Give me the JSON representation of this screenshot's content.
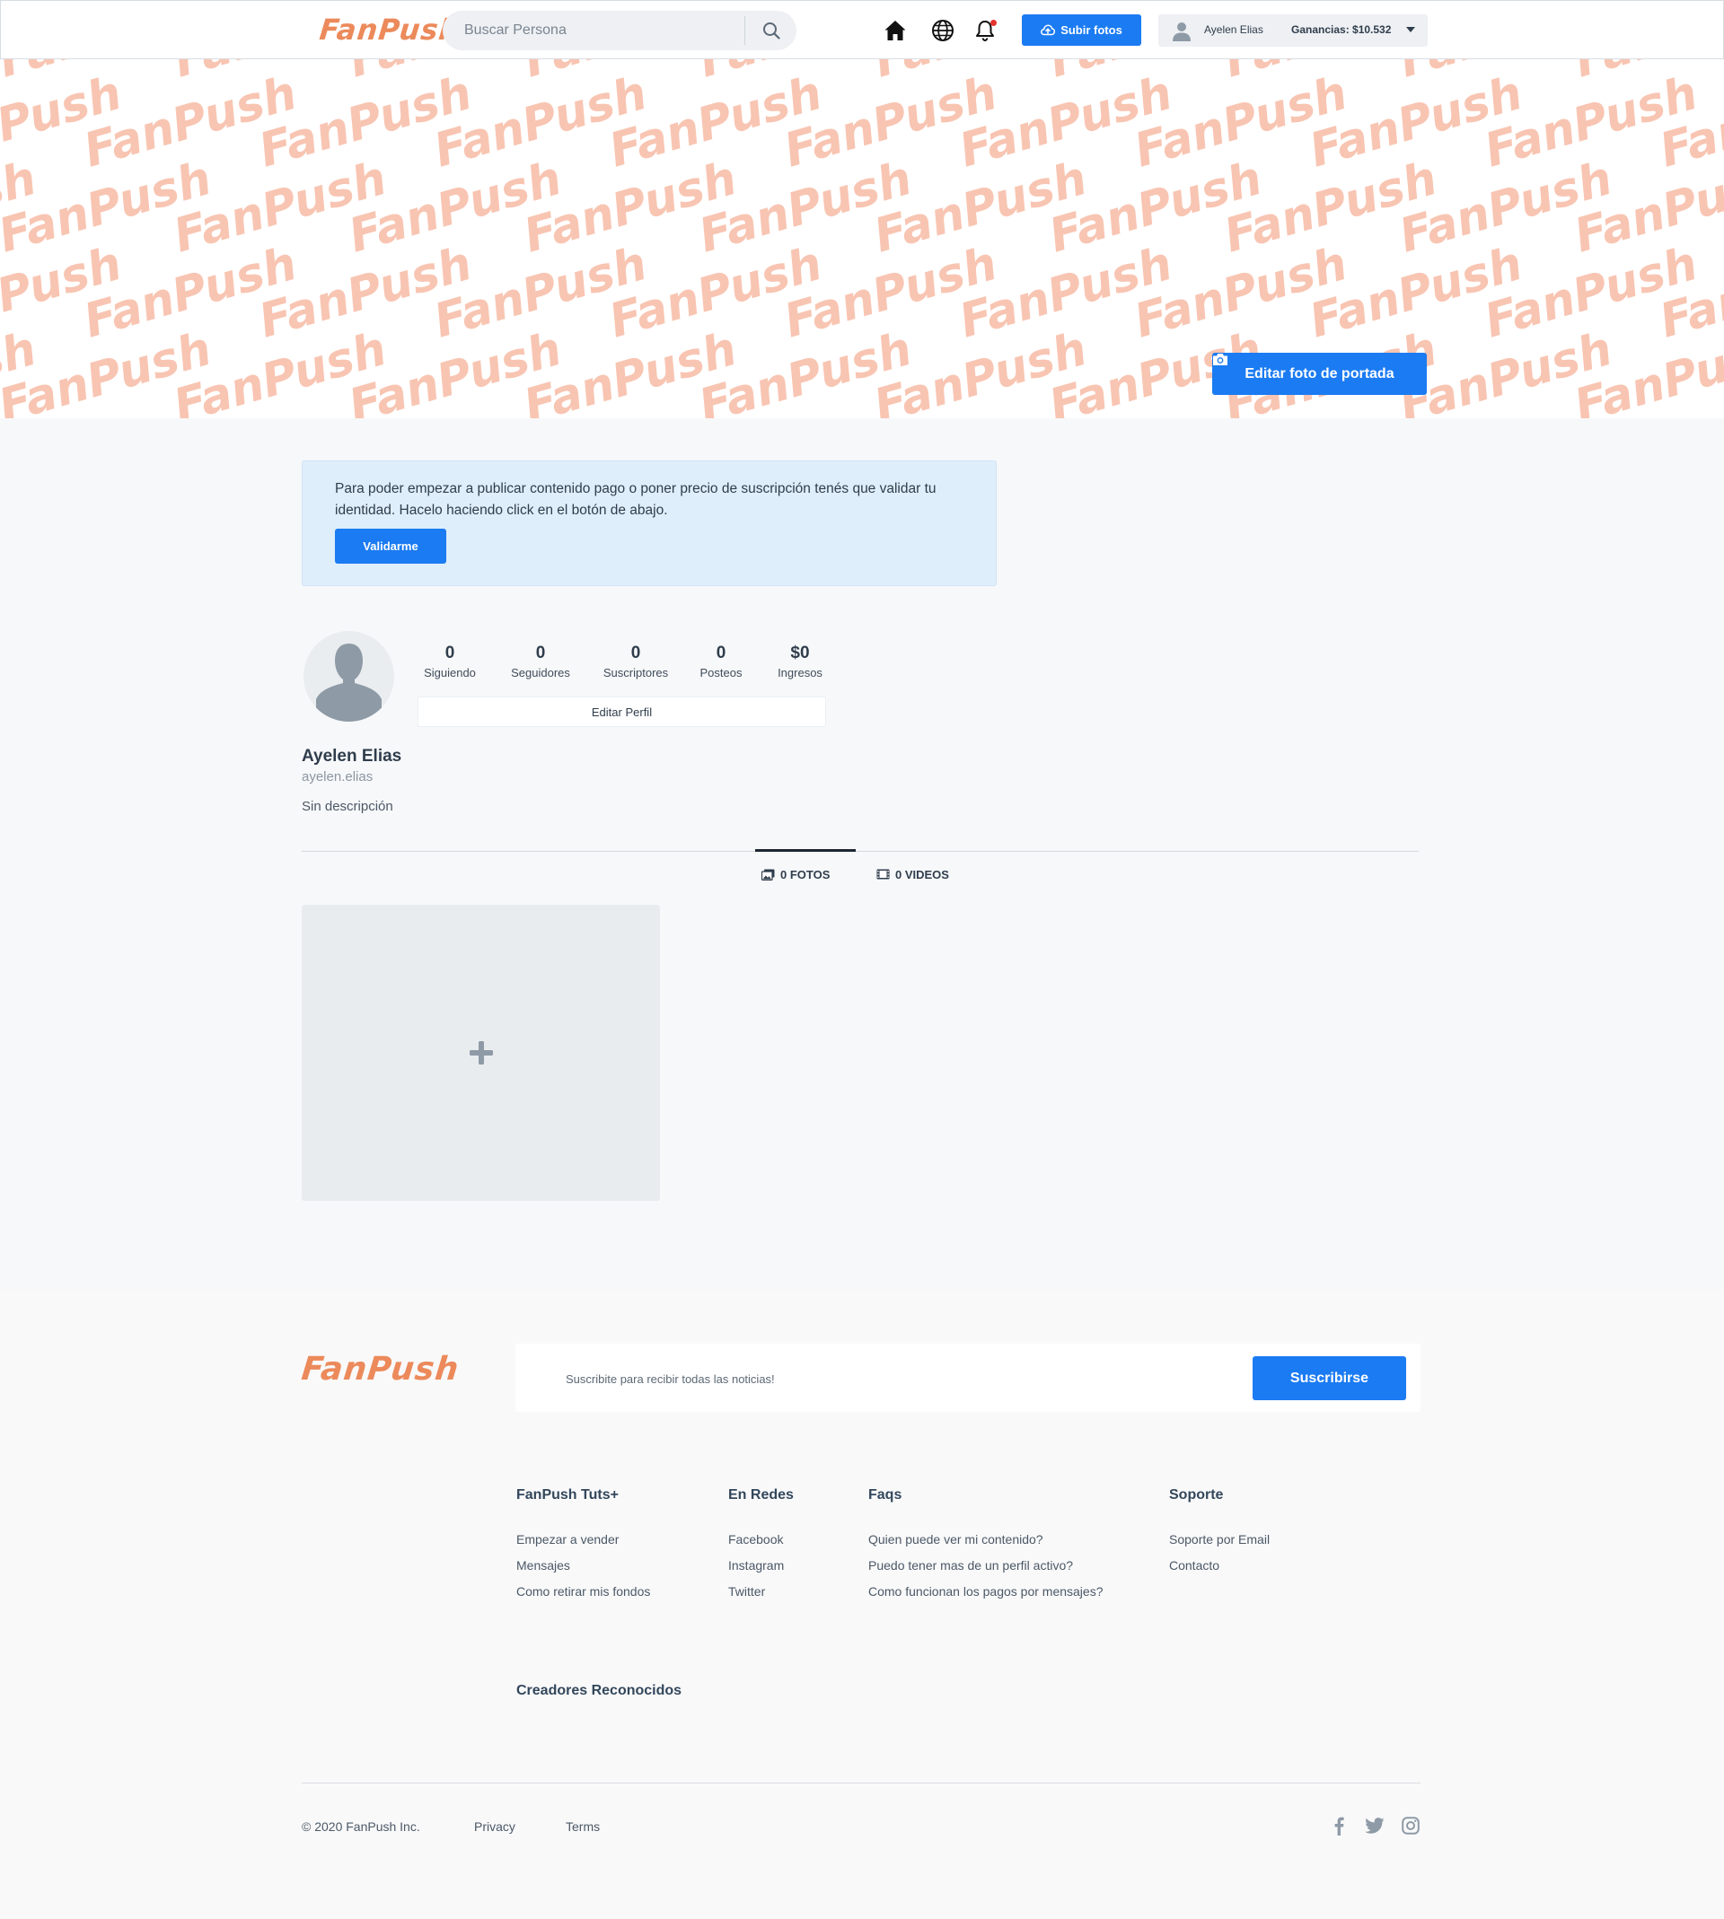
{
  "brand": {
    "name": "FanPush",
    "logo_color": "#ec8a5b",
    "accent": "#1b7bf2"
  },
  "header": {
    "search": {
      "placeholder": "Buscar Persona",
      "icon": "search-icon"
    },
    "nav_icons": [
      "home-icon",
      "globe-icon",
      "bell-icon"
    ],
    "upload_label": "Subir fotos",
    "user_name": "Ayelen Elias",
    "earnings": "Ganancias: $10.532"
  },
  "cover": {
    "watermark_text": "FanPush",
    "watermark_color": "#f8c5b2",
    "edit_cover_label": "Editar foto de portada"
  },
  "alert": {
    "message": "Para poder empezar a publicar contenido pago o poner precio de suscripción tenés que validar tu identidad. Hacelo haciendo click en el botón de abajo.",
    "button_label": "Validarme"
  },
  "profile": {
    "name": "Ayelen Elias",
    "handle": "ayelen.elias",
    "description": "Sin descripción",
    "edit_label": "Editar Perfil",
    "stats": [
      {
        "value": "0",
        "label": "Siguiendo"
      },
      {
        "value": "0",
        "label": "Seguidores"
      },
      {
        "value": "0",
        "label": "Suscriptores"
      },
      {
        "value": "0",
        "label": "Posteos"
      },
      {
        "value": "$0",
        "label": "Ingresos"
      }
    ]
  },
  "tabs": [
    {
      "label": "0 FOTOS",
      "icon": "photos-icon",
      "active": true
    },
    {
      "label": "0 VIDEOS",
      "icon": "film-icon",
      "active": false
    }
  ],
  "gallery": {
    "add_icon": "plus-icon"
  },
  "footer": {
    "newsletter_placeholder": "Suscribite para recibir todas las noticias!",
    "subscribe_label": "Suscribirse",
    "columns": [
      {
        "title": "FanPush Tuts+",
        "links": [
          "Empezar a vender",
          "Mensajes",
          "Como retirar mis fondos"
        ]
      },
      {
        "title": "En Redes",
        "links": [
          "Facebook",
          "Instagram",
          "Twitter"
        ]
      },
      {
        "title": "Faqs",
        "links": [
          "Quien puede ver mi contenido?",
          "Puedo tener mas de un perfil activo?",
          "Como funcionan los pagos por mensajes?"
        ]
      },
      {
        "title": "Soporte",
        "links": [
          "Soporte por Email",
          "Contacto"
        ]
      }
    ],
    "creators_title": "Creadores Reconocidos",
    "copyright": "© 2020 FanPush Inc.",
    "privacy": "Privacy",
    "terms": "Terms",
    "social_icons": [
      "facebook-icon",
      "twitter-icon",
      "instagram-icon"
    ]
  }
}
